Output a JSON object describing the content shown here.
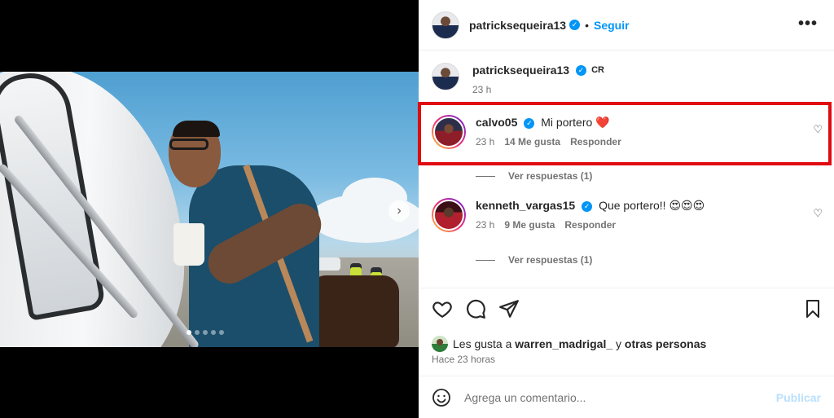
{
  "post": {
    "author": "patricksequeira13",
    "follow_label": "Seguir",
    "separator": "•",
    "more_label": "•••",
    "caption_location": "CR",
    "caption_time": "23 h"
  },
  "carousel": {
    "next_label": "›",
    "dot_count": 5,
    "active_dot": 1
  },
  "comments": [
    {
      "username": "calvo05",
      "text": "Mi portero ❤️",
      "time": "23 h",
      "likes": "14 Me gusta",
      "reply_label": "Responder",
      "view_replies": "Ver respuestas (1)",
      "highlighted": true
    },
    {
      "username": "kenneth_vargas15",
      "text": "Que portero!! 😍😍😍",
      "time": "23 h",
      "likes": "9 Me gusta",
      "reply_label": "Responder",
      "view_replies": "Ver respuestas (1)",
      "highlighted": false
    }
  ],
  "likes_summary": {
    "prefix": "Les gusta a",
    "user": "warren_madrigal_",
    "middle": "y",
    "suffix": "otras personas"
  },
  "posted_ago": "Hace 23 horas",
  "composer": {
    "placeholder": "Agrega un comentario...",
    "publish_label": "Publicar"
  },
  "colors": {
    "accent": "#0095f6",
    "highlight_box": "#e00b10",
    "heart": "#ed4956"
  }
}
